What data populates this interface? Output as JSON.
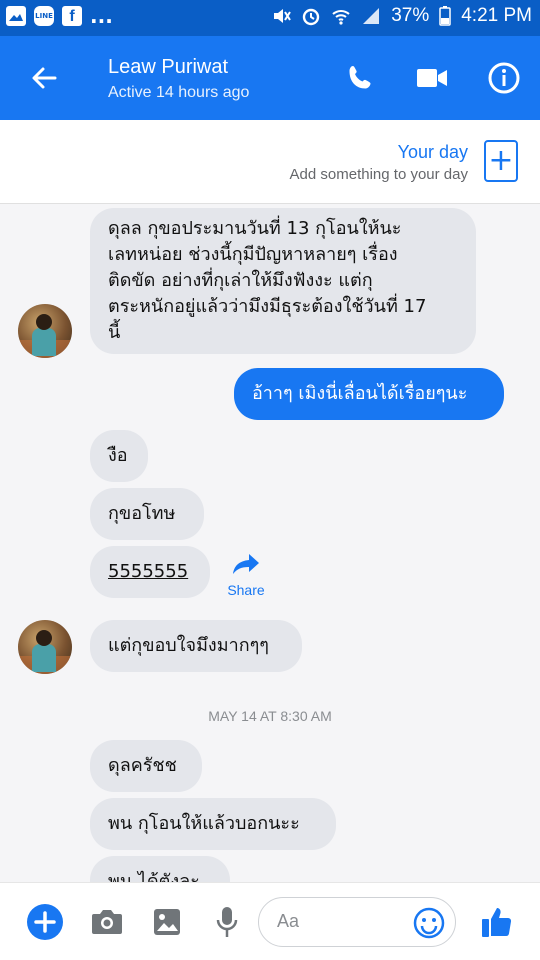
{
  "status_bar": {
    "left_icons": [
      "image-icon",
      "line-app-icon",
      "facebook-icon"
    ],
    "line_label": "LINE",
    "fb_label": "f",
    "overflow": "...",
    "battery": "37%",
    "time": "4:21 PM"
  },
  "header": {
    "name": "Leaw Puriwat",
    "status": "Active 14 hours ago",
    "icons": [
      "back-arrow-icon",
      "phone-icon",
      "video-camera-icon",
      "info-icon"
    ],
    "accent": "#1877f2"
  },
  "your_day": {
    "title": "Your day",
    "subtitle": "Add something to your day",
    "plus": "+"
  },
  "messages": [
    {
      "dir": "in",
      "text": "ดุลล กุขอประมานวันที่ 13 กุโอนให้นะ\nเลทหน่อย ช่วงนี้กุมีปัญหาหลายๆ เรื่อง\nติดขัด อย่างที่กุเล่าให้มึงฟังงะ แต่กุ\nตระหนักอยู่แล้วว่ามึงมีธุระต้องใช้วันที่ 17\nนี้"
    },
    {
      "dir": "out",
      "text": "อ้าาๆ เมิงนี่เลื่อนได้เรื่อยๆนะ"
    },
    {
      "dir": "in",
      "text": "งือ"
    },
    {
      "dir": "in",
      "text": "กุขอโทษ"
    },
    {
      "dir": "in",
      "text": "5555555"
    },
    {
      "dir": "in",
      "text": "แต่กุขอบใจมึงมากๆๆ"
    },
    {
      "dir": "in",
      "text": "ดุลครัชช"
    },
    {
      "dir": "in",
      "text": "พน กุโอนให้แล้วบอกนะะ"
    },
    {
      "dir": "in",
      "text": "พน ได้ตังละ"
    }
  ],
  "share_label": "Share",
  "timestamp": "MAY 14 AT 8:30 AM",
  "composer": {
    "placeholder": "Aa",
    "icons": [
      "plus-circle-icon",
      "camera-icon",
      "gallery-icon",
      "microphone-icon",
      "emoji-icon",
      "thumbs-up-icon"
    ]
  }
}
